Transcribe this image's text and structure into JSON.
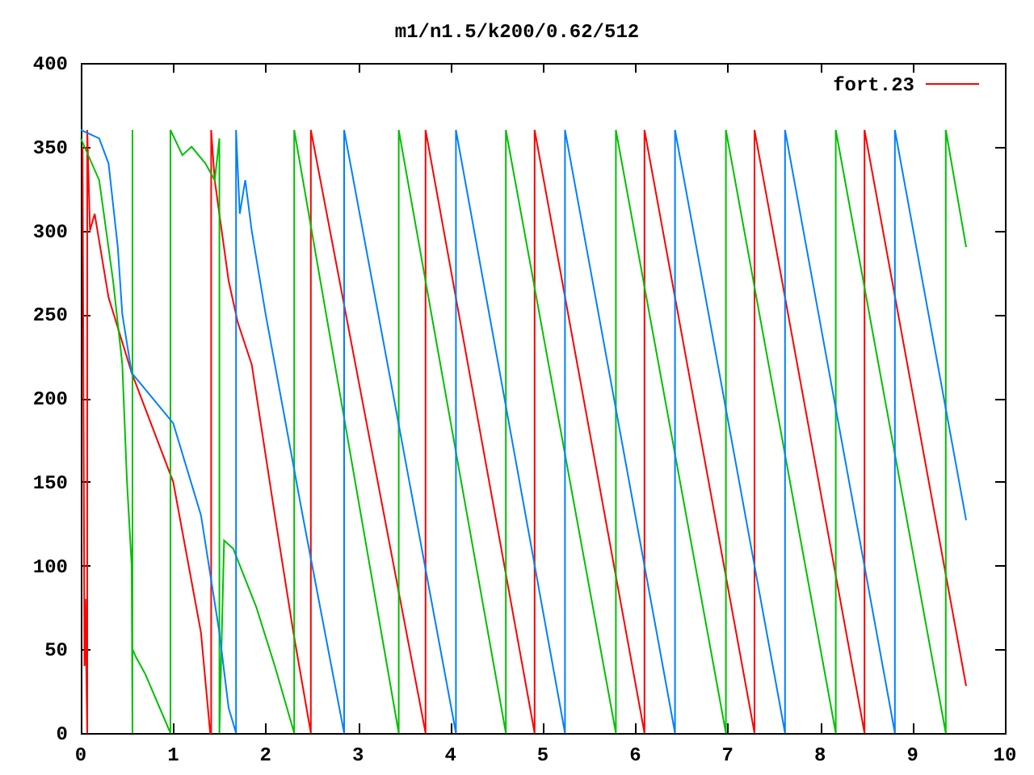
{
  "plot": {
    "chart_data": {
      "type": "line",
      "title": "m1/n1.5/k200/0.62/512",
      "xlim": [
        0,
        10
      ],
      "ylim": [
        0,
        400
      ],
      "xticks": [
        0,
        1,
        2,
        3,
        4,
        5,
        6,
        7,
        8,
        9,
        10
      ],
      "yticks": [
        0,
        50,
        100,
        150,
        200,
        250,
        300,
        350,
        400
      ],
      "series": [
        {
          "name": "fort.23",
          "color": "#ff0000",
          "x": [
            0.02,
            0.04,
            0.05,
            0.06,
            0.07,
            0.07,
            0.1,
            0.15,
            0.3,
            0.55,
            1,
            1.3,
            1.4,
            1.41,
            1.41,
            1.45,
            1.6,
            1.7,
            1.85,
            2.1,
            2.3,
            2.49,
            2.49,
            3.73,
            3.73,
            4.91,
            4.91,
            6.1,
            6.1,
            7.29,
            7.29,
            8.48,
            8.48,
            9.58
          ],
          "values": [
            350,
            40,
            80,
            40,
            0,
            360,
            300,
            310,
            260,
            215,
            150,
            60,
            0,
            0,
            360,
            330,
            270,
            245,
            220,
            130,
            60,
            0,
            360,
            0,
            360,
            0,
            360,
            0,
            360,
            0,
            360,
            0,
            360,
            28
          ]
        },
        {
          "color": "#00c000",
          "x": [
            0,
            0.2,
            0.35,
            0.45,
            0.5,
            0.55,
            0.56,
            0.56,
            0.56,
            0.6,
            0.65,
            0.7,
            0.97,
            0.97,
            1.1,
            1.2,
            1.35,
            1.45,
            1.5,
            1.5,
            1.55,
            1.65,
            1.9,
            2.1,
            2.31,
            2.31,
            3.44,
            3.44,
            4.6,
            4.6,
            5.79,
            5.79,
            6.98,
            6.98,
            8.17,
            8.17,
            9.36,
            9.36,
            9.58
          ],
          "values": [
            355,
            330,
            270,
            220,
            150,
            100,
            0,
            360,
            50,
            45,
            40,
            35,
            0,
            360,
            345,
            350,
            340,
            330,
            355,
            0,
            115,
            110,
            75,
            40,
            0,
            360,
            0,
            360,
            0,
            360,
            0,
            360,
            0,
            360,
            0,
            360,
            0,
            360,
            290
          ]
        },
        {
          "color": "#0080ff",
          "x": [
            0,
            0.2,
            0.3,
            0.4,
            0.45,
            0.55,
            1,
            1.3,
            1.5,
            1.6,
            1.68,
            1.68,
            1.72,
            1.78,
            1.85,
            2,
            2.4,
            2.85,
            2.85,
            4.06,
            4.06,
            5.24,
            5.24,
            6.43,
            6.43,
            7.62,
            7.62,
            8.81,
            8.81,
            9.58
          ],
          "values": [
            360,
            355,
            340,
            290,
            250,
            215,
            185,
            130,
            60,
            15,
            0,
            360,
            310,
            330,
            300,
            250,
            130,
            0,
            360,
            0,
            360,
            0,
            360,
            0,
            360,
            0,
            360,
            0,
            360,
            127
          ]
        }
      ]
    }
  }
}
